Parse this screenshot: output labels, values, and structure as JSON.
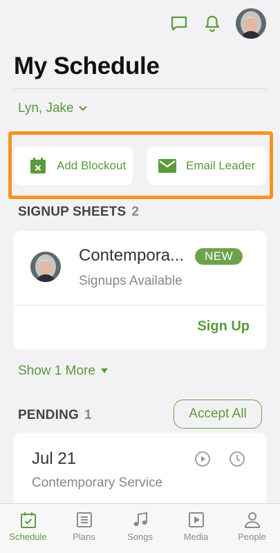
{
  "header": {
    "title": "My Schedule",
    "person_selector": "Lyn, Jake"
  },
  "actions": {
    "add_blockout": "Add Blockout",
    "email_leader": "Email Leader"
  },
  "signup_sheets": {
    "label": "SIGNUP SHEETS",
    "count": "2",
    "item": {
      "title": "Contempora...",
      "badge": "NEW",
      "subtitle": "Signups Available",
      "action": "Sign Up"
    },
    "show_more": "Show 1 More"
  },
  "pending": {
    "label": "PENDING",
    "count": "1",
    "accept_all": "Accept All",
    "item": {
      "date": "Jul 21",
      "service": "Contemporary Service"
    }
  },
  "tabs": [
    {
      "label": "Schedule",
      "icon": "calendar-check-icon"
    },
    {
      "label": "Plans",
      "icon": "list-icon"
    },
    {
      "label": "Songs",
      "icon": "music-note-icon"
    },
    {
      "label": "Media",
      "icon": "play-icon"
    },
    {
      "label": "People",
      "icon": "person-icon"
    }
  ],
  "colors": {
    "accent": "#5b9a3c",
    "highlight": "#f6921e"
  }
}
